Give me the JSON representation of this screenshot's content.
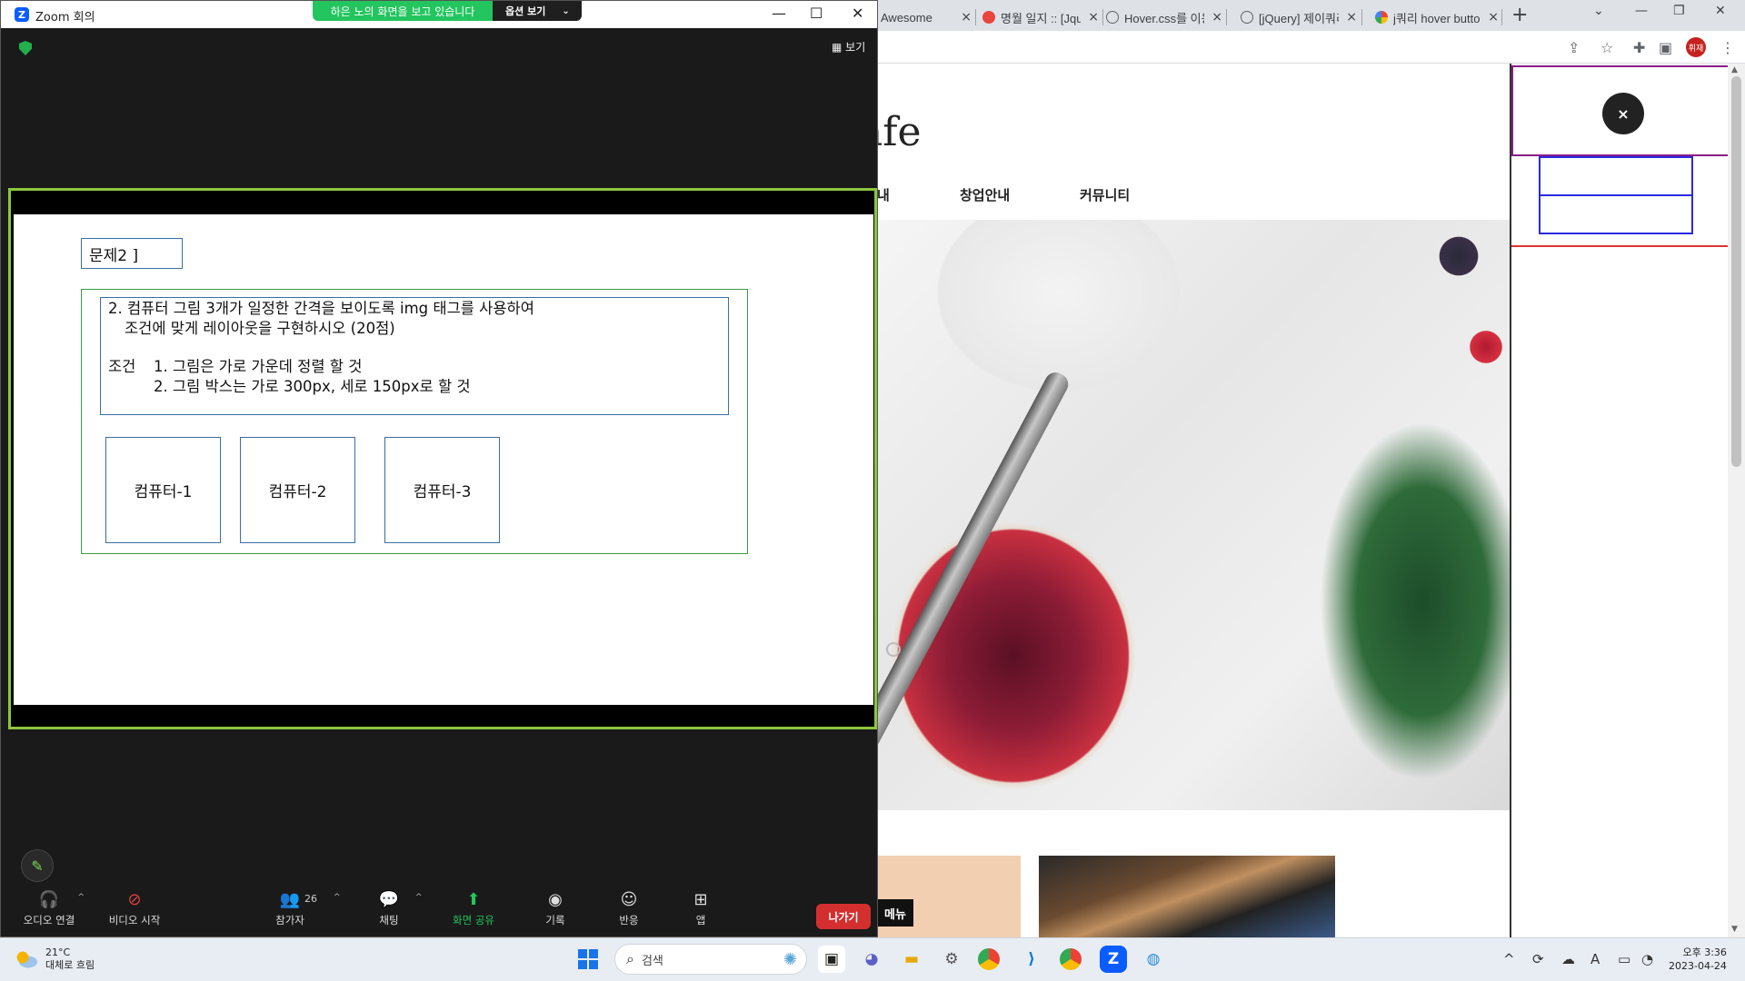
{
  "browser": {
    "tabs": [
      {
        "label": "Awesome",
        "icon_color": "#7a7a7a"
      },
      {
        "label": "명월 일지 :: [Jquery]",
        "icon_color": "#e8453c"
      },
      {
        "label": "Hover.css를 이용한",
        "icon_color": "#5f6368"
      },
      {
        "label": "[jQuery] 제이쿼리",
        "icon_color": "#5f6368"
      },
      {
        "label": "j쿼리 hover button",
        "icon_color": "#4285f4"
      }
    ],
    "new_tab": "+",
    "profile_label": "휘재",
    "site": {
      "logo_fragment": "afe",
      "nav": [
        "내",
        "창업안내",
        "커뮤니티"
      ],
      "menu_badge": "메뉴"
    },
    "panel": {
      "close_label": "×"
    }
  },
  "zoom": {
    "title": "Zoom 회의",
    "share_banner": "하은 노의 화면을 보고 있습니다",
    "view_options": "옵션 보기",
    "view_label": "보기",
    "slide": {
      "question_title": "문제2 ]",
      "lines": [
        "2. 컴퓨터 그림 3개가 일정한 간격을 보이도록 img 태그를 사용하여",
        "조건에 맞게 레이아웃을 구현하시오 (20점)"
      ],
      "condition_label": "조건",
      "conditions": [
        "1. 그림은 가로 가운데 정렬 할 것",
        "2. 그림 박스는 가로 300px, 세로 150px로 할 것"
      ],
      "boxes": [
        "컴퓨터-1",
        "컴퓨터-2",
        "컴퓨터-3"
      ]
    },
    "toolbar": {
      "audio": "오디오 연결",
      "video": "비디오 시작",
      "participants": "참가자",
      "participants_count": "26",
      "chat": "채팅",
      "share": "화면 공유",
      "record": "기록",
      "reactions": "반응",
      "apps": "앱",
      "leave": "나가기"
    }
  },
  "taskbar": {
    "weather_temp": "21°C",
    "weather_desc": "대체로 흐림",
    "search_placeholder": "검색",
    "clock_time": "오후 3:36",
    "clock_date": "2023-04-24"
  }
}
